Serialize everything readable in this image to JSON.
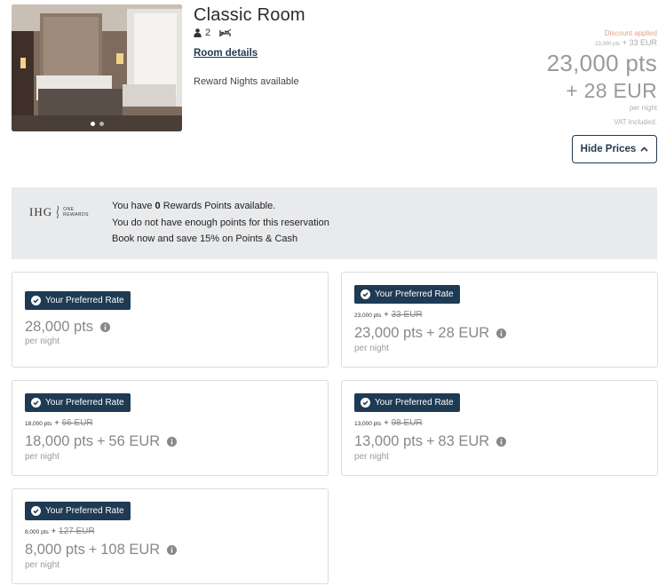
{
  "room": {
    "title": "Classic Room",
    "guests": "2",
    "details_link": "Room details",
    "availability": "Reward Nights available",
    "photo_icon": "room-photo"
  },
  "price_summary": {
    "discount_label": "Discount applied",
    "original_small_pts": "23,000 pts",
    "original_small_sep": "+",
    "original_small_eur": "33 EUR",
    "points": "23,000 pts",
    "cash": "+ 28 EUR",
    "per_night": "per night",
    "vat": "VAT Included.",
    "hide_prices_label": "Hide Prices"
  },
  "rewards": {
    "logo_text": "IHG",
    "logo_sub1": "ONE",
    "logo_sub2": "REWARDS",
    "line1_pre": "You have",
    "line1_points": "0",
    "line1_post": "Rewards Points available.",
    "line2": "You do not have enough points for this reservation",
    "line3": "Book now and save 15% on Points & Cash"
  },
  "rates": [
    {
      "badge": "Your Preferred Rate",
      "has_strike": false,
      "price": "28,000 pts",
      "cash": "",
      "per_night": "per night"
    },
    {
      "badge": "Your Preferred Rate",
      "has_strike": true,
      "strike_pts": "23,000 pts",
      "strike_sep": "+",
      "strike_eur": "33 EUR",
      "price": "23,000 pts",
      "plus": "+",
      "cash": "28 EUR",
      "per_night": "per night"
    },
    {
      "badge": "Your Preferred Rate",
      "has_strike": true,
      "strike_pts": "18,000 pts",
      "strike_sep": "+",
      "strike_eur": "66 EUR",
      "price": "18,000 pts",
      "plus": "+",
      "cash": "56 EUR",
      "per_night": "per night"
    },
    {
      "badge": "Your Preferred Rate",
      "has_strike": true,
      "strike_pts": "13,000 pts",
      "strike_sep": "+",
      "strike_eur": "98 EUR",
      "price": "13,000 pts",
      "plus": "+",
      "cash": "83 EUR",
      "per_night": "per night"
    },
    {
      "badge": "Your Preferred Rate",
      "has_strike": true,
      "strike_pts": "8,000 pts",
      "strike_sep": "+",
      "strike_eur": "127 EUR",
      "price": "8,000 pts",
      "plus": "+",
      "cash": "108 EUR",
      "per_night": "per night"
    }
  ],
  "colors": {
    "brand_navy": "#1f3a53",
    "discount": "#e8a07d",
    "banner_bg": "#e9eaec"
  }
}
